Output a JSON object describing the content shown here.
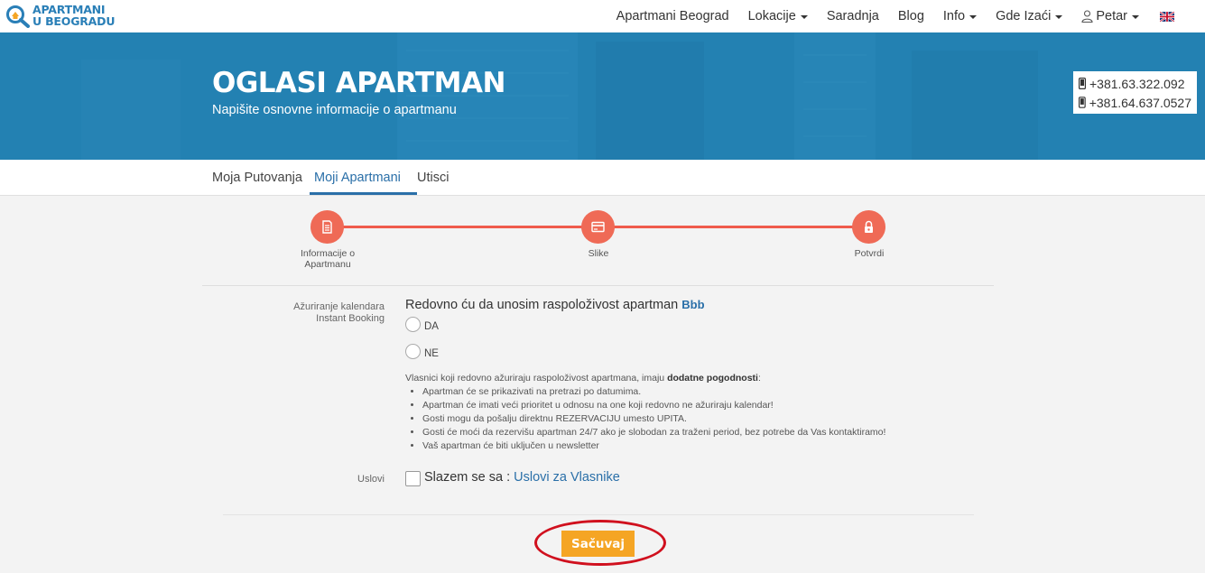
{
  "brand": {
    "line1": "APARTMANI",
    "line2": "U BEOGRADU"
  },
  "nav": {
    "items": [
      {
        "label": "Apartmani Beograd",
        "dropdown": false
      },
      {
        "label": "Lokacije",
        "dropdown": true
      },
      {
        "label": "Saradnja",
        "dropdown": false
      },
      {
        "label": "Blog",
        "dropdown": false
      },
      {
        "label": "Info",
        "dropdown": true
      },
      {
        "label": "Gde Izaći",
        "dropdown": true
      }
    ],
    "user": "Petar",
    "language_icon": "uk-flag-icon"
  },
  "hero": {
    "title": "OGLASI APARTMAN",
    "subtitle": "Napišite osnovne informacije o apartmanu",
    "phones": [
      "+381.63.322.092",
      "+381.64.637.0527"
    ]
  },
  "tabs": [
    {
      "label": "Moja Putovanja",
      "active": false
    },
    {
      "label": "Moji Apartmani",
      "active": true
    },
    {
      "label": "Utisci",
      "active": false
    }
  ],
  "steps": [
    {
      "label_line1": "Informacije o",
      "label_line2": "Apartmanu",
      "icon": "document-icon"
    },
    {
      "label_line1": "Slike",
      "label_line2": "",
      "icon": "card-icon"
    },
    {
      "label_line1": "Potvrdi",
      "label_line2": "",
      "icon": "lock-icon"
    }
  ],
  "form": {
    "calendar_label_line1": "Ažuriranje kalendara",
    "calendar_label_line2": "Instant Booking",
    "question_text": "Redovno ću da unosim raspoloživost apartman",
    "apartment_name": "Bbb",
    "options": [
      "DA",
      "NE"
    ],
    "info_intro": "Vlasnici koji redovno ažuriraju raspoloživost apartmana, imaju",
    "info_bold": "dodatne pogodnosti",
    "info_colon": ":",
    "benefits": [
      "Apartman će se prikazivati na pretrazi po datumima.",
      "Apartman će imati veći prioritet u odnosu na one koji redovno ne ažuriraju kalendar!",
      "Gosti mogu da pošalju direktnu REZERVACIJU umesto UPITA.",
      "Gosti će moći da rezervišu apartman 24/7 ako je slobodan za traženi period, bez potrebe da Vas kontaktiramo!",
      "Vaš apartman će biti uključen u newsletter"
    ],
    "terms_label": "Uslovi",
    "terms_text": "Slazem se sa : ",
    "terms_link": "Uslovi za Vlasnike",
    "save_label": "Sačuvaj"
  },
  "colors": {
    "hero_blue": "#2381b2",
    "accent_blue": "#2a6fa8",
    "step_red": "#ef6a56",
    "save_orange": "#f5a524",
    "highlight_red": "#d0101e"
  }
}
